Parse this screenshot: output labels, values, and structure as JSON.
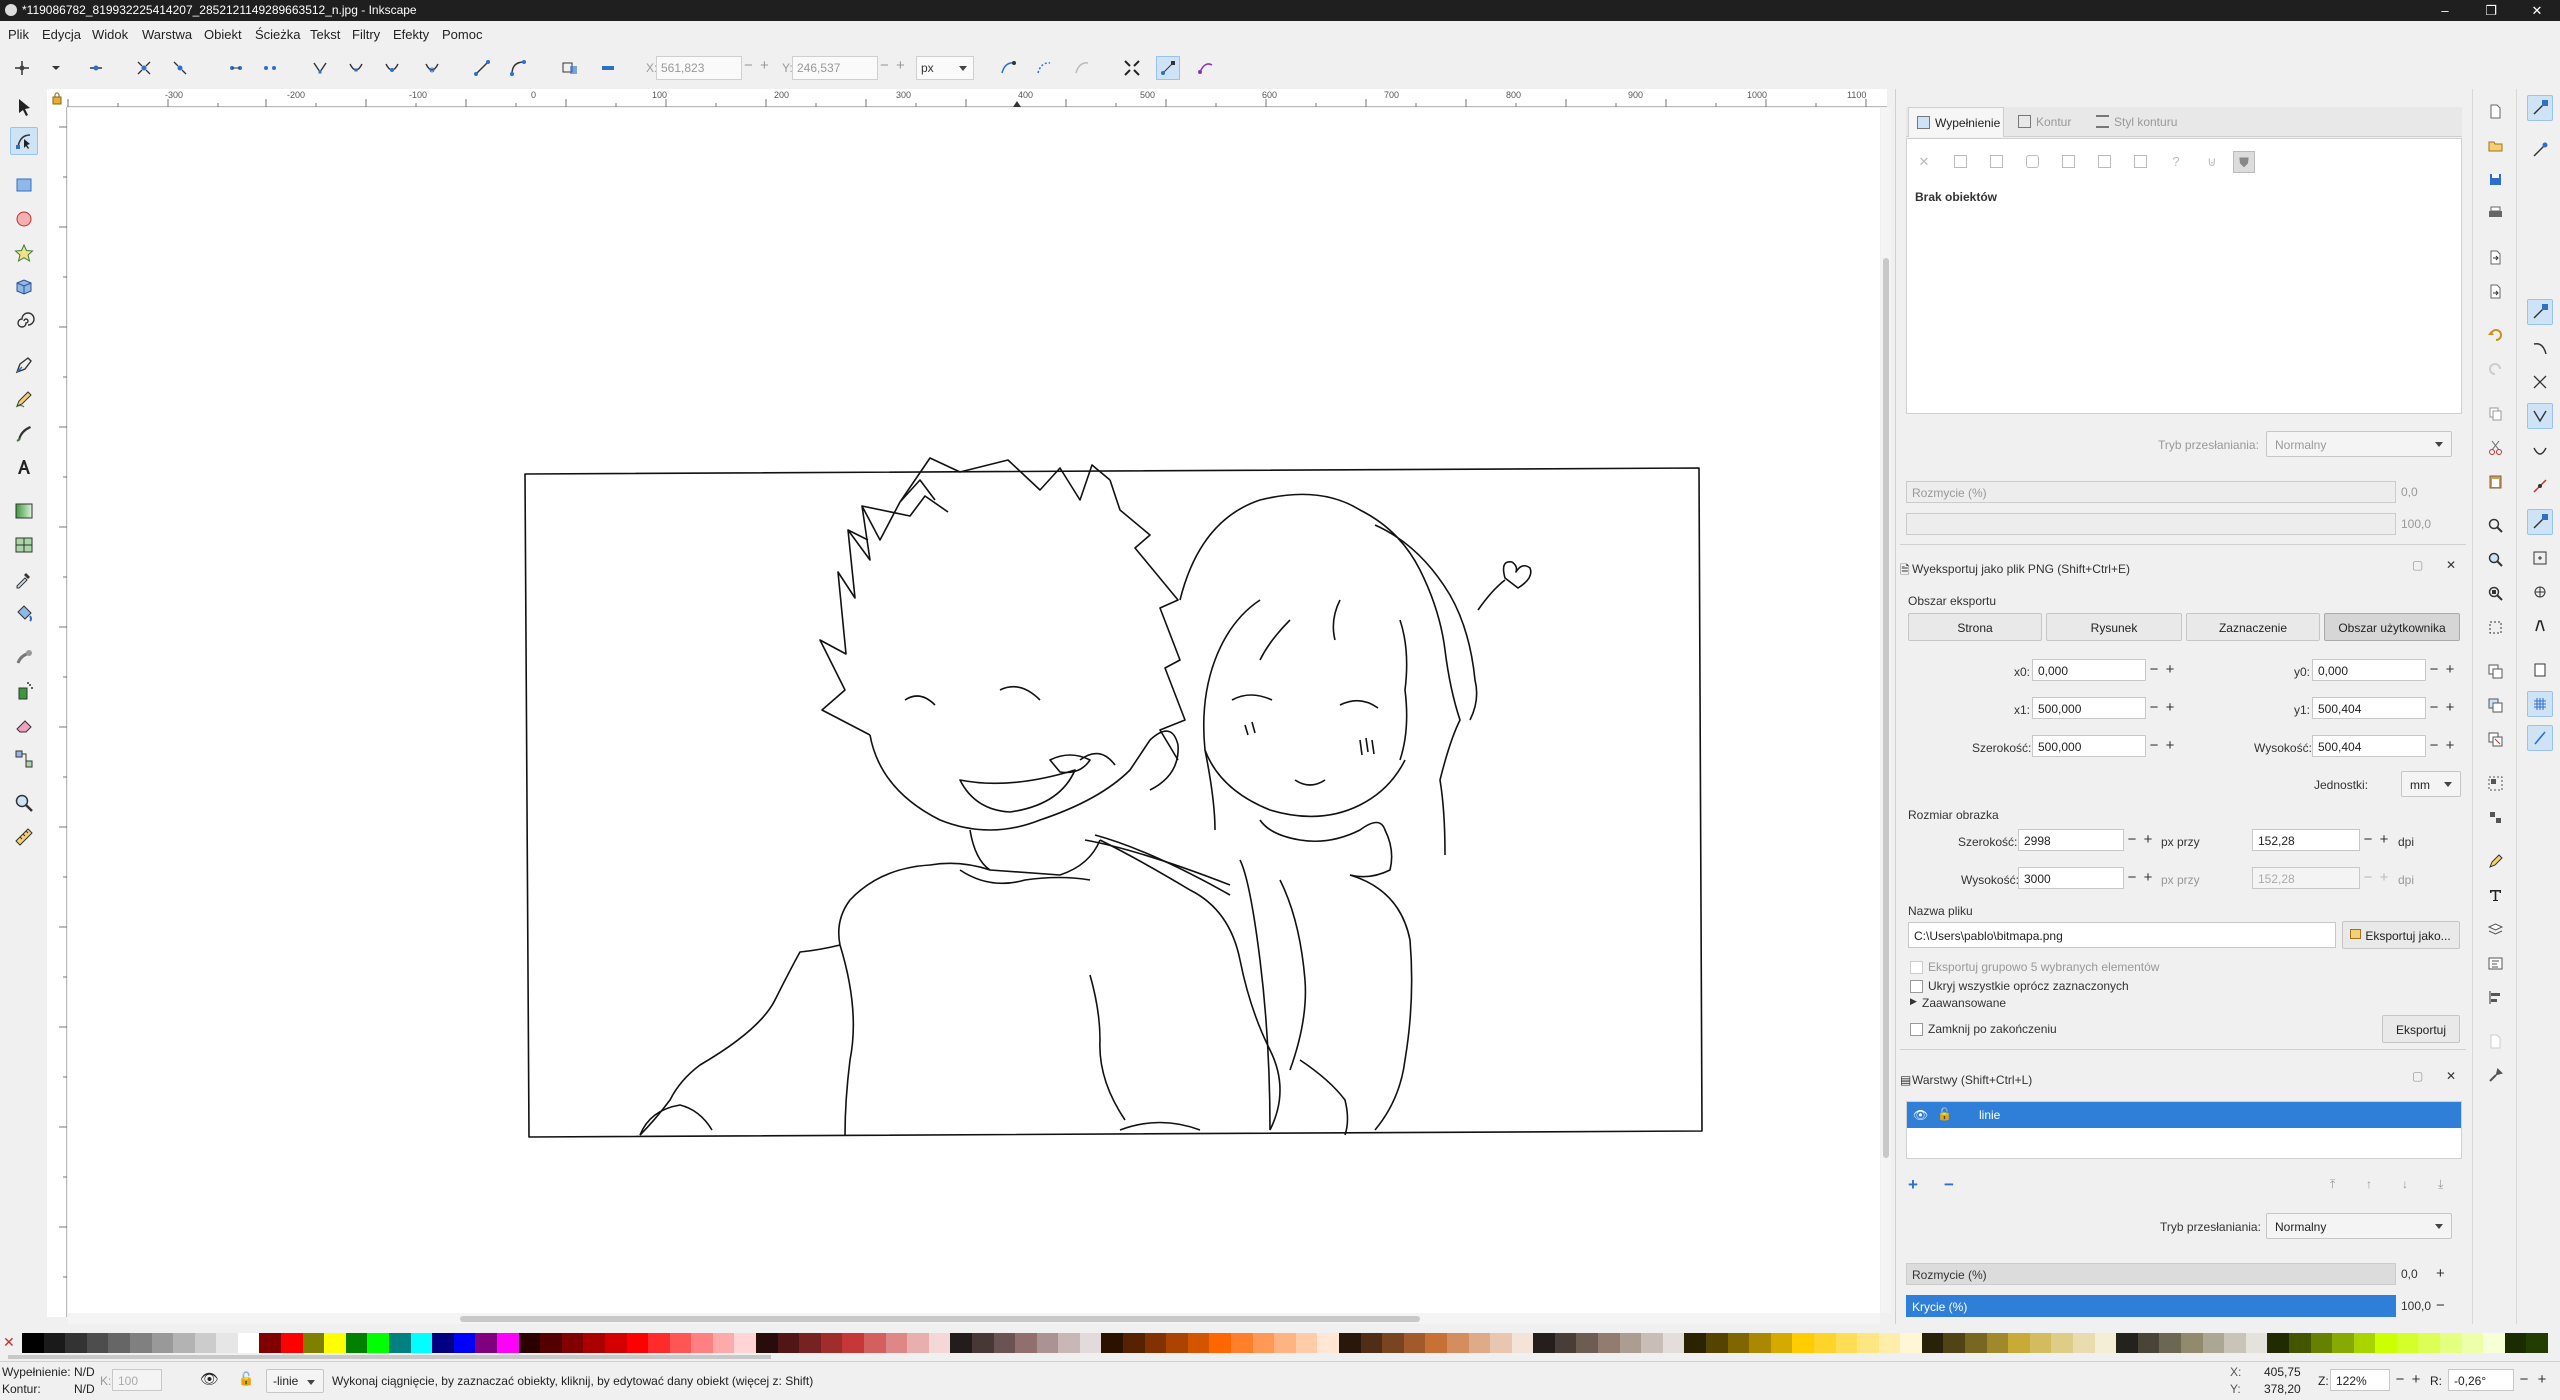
{
  "window": {
    "title": "*119086782_819932225414207_2852121149289663512_n.jpg - Inkscape",
    "min": "–",
    "max": "❐",
    "close": "✕"
  },
  "menu": [
    "Plik",
    "Edycja",
    "Widok",
    "Warstwa",
    "Obiekt",
    "Ścieżka",
    "Tekst",
    "Filtry",
    "Efekty",
    "Pomoc"
  ],
  "toolctrl": {
    "x_label": "X:",
    "x_value": "561,823",
    "y_label": "Y:",
    "y_value": "246,537",
    "unit": "px"
  },
  "ruler": {
    "ticks": [
      "-300",
      "-200",
      "-100",
      "0",
      "100",
      "200",
      "300",
      "400",
      "500",
      "600",
      "700",
      "800",
      "900",
      "1000",
      "1100"
    ]
  },
  "fill_panel": {
    "tabs": [
      "Wypełnienie",
      "Kontur",
      "Styl konturu"
    ],
    "no_objects": "Brak obiektów",
    "blend_label": "Tryb przesłaniania:",
    "blend_value": "Normalny",
    "blur_label": "Rozmycie (%)",
    "blur_value": "0,0",
    "opacity_value": "100,0",
    "fill_buttons": [
      "✕",
      "?"
    ]
  },
  "export_panel": {
    "title": "Wyeksportuj jako plik PNG (Shift+Ctrl+E)",
    "area_header": "Obszar eksportu",
    "area_buttons": [
      "Strona",
      "Rysunek",
      "Zaznaczenie",
      "Obszar użytkownika"
    ],
    "x0_label": "x0:",
    "x0_value": "0,000",
    "y0_label": "y0:",
    "y0_value": "0,000",
    "x1_label": "x1:",
    "x1_value": "500,000",
    "y1_label": "y1:",
    "y1_value": "500,404",
    "width_label": "Szerokość:",
    "width_value": "500,000",
    "height_label": "Wysokość:",
    "height_value": "500,404",
    "units_label": "Jednostki:",
    "units_value": "mm",
    "image_size_header": "Rozmiar obrazka",
    "img_width_label": "Szerokość:",
    "img_width_value": "2998",
    "img_height_label": "Wysokość:",
    "img_height_value": "3000",
    "px_at": "px przy",
    "dpi_value": "152,28",
    "dpi_value2": "152,28",
    "dpi": "dpi",
    "filename_header": "Nazwa pliku",
    "filename_value": "C:\\Users\\pablo\\bitmapa.png",
    "export_as": "Eksportuj jako...",
    "batch": "Eksportuj grupowo 5 wybranych elementów",
    "hide": "Ukryj wszystkie oprócz zaznaczonych",
    "advanced": "Zaawansowane",
    "close_after": "Zamknij po zakończeniu",
    "export_btn": "Eksportuj"
  },
  "layers_panel": {
    "title": "Warstwy (Shift+Ctrl+L)",
    "layer_name": "linie",
    "add": "+",
    "remove": "−",
    "blend_label": "Tryb przesłaniania:",
    "blend_value": "Normalny",
    "blur_label": "Rozmycie (%)",
    "blur_value": "0,0",
    "opacity_label": "Krycie (%)",
    "opacity_value": "100,0"
  },
  "status": {
    "fill_label": "Wypełnienie:",
    "fill_value": "N/D",
    "stroke_label": "Kontur:",
    "stroke_value": "N/D",
    "k_label": "K:",
    "k_value": "100",
    "layer": "-linie",
    "message": "Wykonaj ciągnięcie, by zaznaczać obiekty, kliknij, by edytować dany obiekt (więcej z: Shift)",
    "x_label": "X:",
    "x_value": "405,75",
    "y_label": "Y:",
    "y_value": "378,20",
    "zoom_label": "Z:",
    "zoom_value": "122%",
    "rot_label": "R:",
    "rot_value": "-0,26°"
  },
  "palette_colors": [
    "#000000",
    "#1a1a1a",
    "#333333",
    "#4d4d4d",
    "#666666",
    "#808080",
    "#999999",
    "#b3b3b3",
    "#cccccc",
    "#e6e6e6",
    "#ffffff",
    "#800000",
    "#ff0000",
    "#808000",
    "#ffff00",
    "#008000",
    "#00ff00",
    "#008080",
    "#00ffff",
    "#000080",
    "#0000ff",
    "#800080",
    "#ff00ff",
    "#2b0000",
    "#550000",
    "#800000",
    "#aa0000",
    "#d40000",
    "#ff0000",
    "#ff2a2a",
    "#ff5555",
    "#ff8080",
    "#ffaaaa",
    "#ffd5d5",
    "#280b0b",
    "#501616",
    "#782121",
    "#a02c2c",
    "#c83737",
    "#d35f5f",
    "#de8787",
    "#e9afaf",
    "#f4d7d7",
    "#241c1c",
    "#483737",
    "#6c5353",
    "#916f6f",
    "#ac9393",
    "#c8b7b7",
    "#e3dbdb",
    "#2b1100",
    "#552200",
    "#803300",
    "#aa4400",
    "#d45500",
    "#ff6600",
    "#ff7f2a",
    "#ff9955",
    "#ffb380",
    "#ffccaa",
    "#ffe6d5",
    "#28170b",
    "#502d16",
    "#784421",
    "#a05a2c",
    "#c87137",
    "#d38d5f",
    "#deaa87",
    "#e9c6af",
    "#f4e3d7",
    "#241f1c",
    "#483e37",
    "#6c5d53",
    "#917c6f",
    "#ac9d93",
    "#c8beb7",
    "#e3dedb",
    "#2b2200",
    "#554400",
    "#806600",
    "#aa8800",
    "#d4aa00",
    "#ffcc00",
    "#ffd42a",
    "#ffdd55",
    "#ffe680",
    "#ffeeaa",
    "#fff6d5",
    "#28220b",
    "#504416",
    "#786721",
    "#a0892c",
    "#c8ab37",
    "#d3bc5f",
    "#decd87",
    "#e9ddaf",
    "#f4eed7",
    "#24221c",
    "#484537",
    "#6c6753",
    "#918a6f",
    "#aca793",
    "#c8c4b7",
    "#e3e2db",
    "#222b00",
    "#445500",
    "#668000",
    "#88aa00",
    "#aad400",
    "#ccff00",
    "#d4ff2a",
    "#ddff55",
    "#e5ff80",
    "#eeffaa",
    "#f6ffd5",
    "#1c2b00",
    "#223d00"
  ]
}
